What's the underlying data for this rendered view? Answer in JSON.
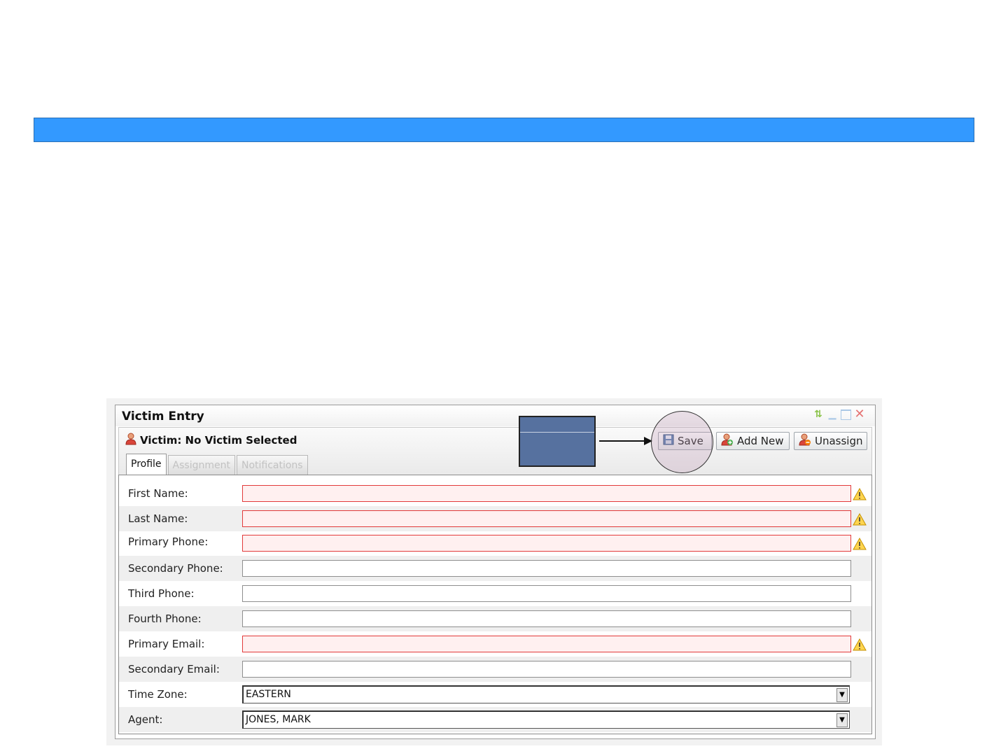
{
  "panel": {
    "title": "Victim Entry",
    "victim_label": "Victim: No Victim Selected",
    "toolbar": {
      "save_label": "Save",
      "add_new_label": "Add New",
      "unassign_label": "Unassign"
    },
    "tabs": [
      {
        "label": "Profile",
        "active": true
      },
      {
        "label": "Assignment",
        "active": false
      },
      {
        "label": "Notifications",
        "active": false
      }
    ],
    "form": {
      "first_name": {
        "label": "First Name:",
        "value": "",
        "required": true
      },
      "last_name": {
        "label": "Last Name:",
        "value": "",
        "required": true
      },
      "primary_phone": {
        "label": "Primary Phone:",
        "value": "",
        "required": true
      },
      "secondary_phone": {
        "label": "Secondary Phone:",
        "value": ""
      },
      "third_phone": {
        "label": "Third Phone:",
        "value": ""
      },
      "fourth_phone": {
        "label": "Fourth Phone:",
        "value": ""
      },
      "primary_email": {
        "label": "Primary Email:",
        "value": "",
        "required": true
      },
      "secondary_email": {
        "label": "Secondary Email:",
        "value": ""
      },
      "time_zone": {
        "label": "Time Zone:",
        "value": "EASTERN"
      },
      "agent": {
        "label": "Agent:",
        "value": "JONES, MARK"
      }
    }
  },
  "colors": {
    "top_bar": "#3399ff",
    "invalid_border": "#e23a3a",
    "invalid_fill": "#fff0f0",
    "callout_box": "#56719f"
  },
  "icons": {
    "victim": "person-icon",
    "save": "floppy-disk-icon",
    "add_new": "add-person-icon",
    "unassign": "remove-person-icon",
    "warning": "warning-triangle-icon"
  }
}
